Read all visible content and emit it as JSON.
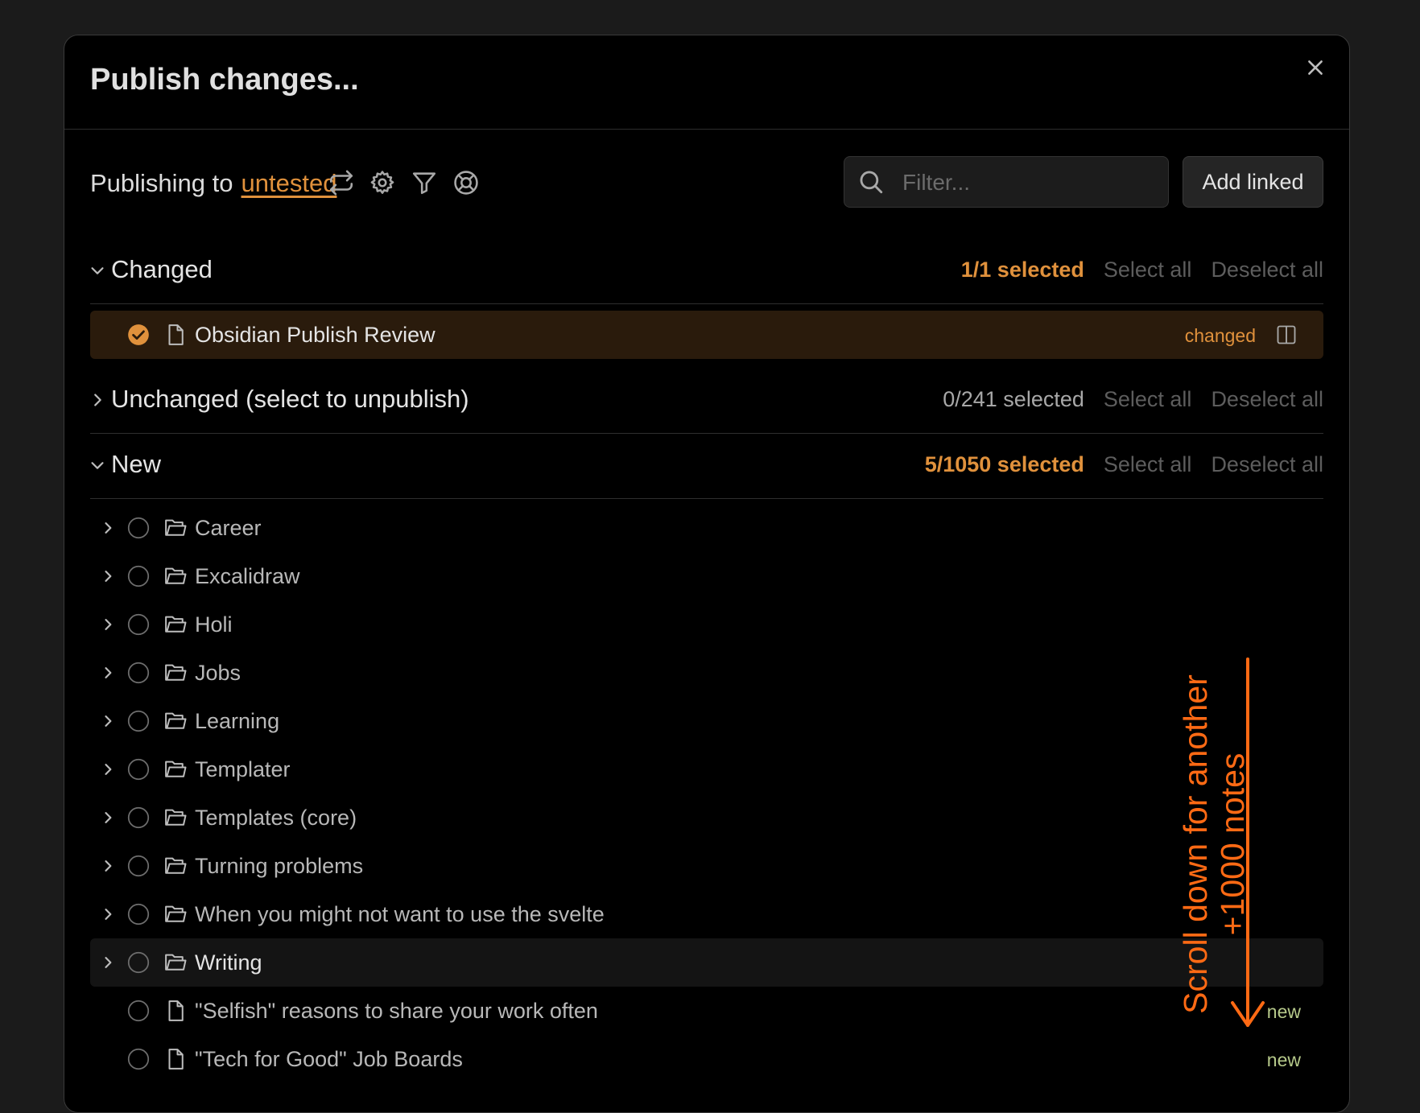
{
  "modal": {
    "title": "Publish changes..."
  },
  "toolbar": {
    "publishing_to_label": "Publishing to",
    "target": "untested",
    "filter_placeholder": "Filter...",
    "filter_value": "",
    "add_linked_label": "Add linked",
    "icons": [
      "sync-icon",
      "gear-icon",
      "filter-icon",
      "help-lifebuoy-icon"
    ]
  },
  "sections": {
    "changed": {
      "title": "Changed",
      "count": "1/1 selected",
      "expanded": true,
      "select_all": "Select all",
      "deselect_all": "Deselect all",
      "items": [
        {
          "label": "Obsidian Publish Review",
          "status": "changed",
          "selected": true,
          "type": "file"
        }
      ]
    },
    "unchanged": {
      "title": "Unchanged (select to unpublish)",
      "count": "0/241 selected",
      "expanded": false,
      "select_all": "Select all",
      "deselect_all": "Deselect all"
    },
    "new": {
      "title": "New",
      "count": "5/1050 selected",
      "expanded": true,
      "select_all": "Select all",
      "deselect_all": "Deselect all",
      "folders": [
        {
          "label": "Career"
        },
        {
          "label": "Excalidraw"
        },
        {
          "label": "Holi"
        },
        {
          "label": "Jobs"
        },
        {
          "label": "Learning"
        },
        {
          "label": "Templater"
        },
        {
          "label": "Templates (core)"
        },
        {
          "label": "Turning problems"
        },
        {
          "label": "When you might not want to use the svelte"
        },
        {
          "label": "Writing"
        }
      ],
      "files": [
        {
          "label": "\"Selfish\" reasons to share your work often",
          "status": "new"
        },
        {
          "label": "\"Tech for Good\" Job Boards",
          "status": "new"
        }
      ]
    }
  },
  "annotation": {
    "line1": "Scroll down for another",
    "line2": "+1000 notes"
  },
  "colors": {
    "accent": "#e0913c",
    "new_status": "#b6c98a",
    "annotation": "#ff6a14"
  }
}
